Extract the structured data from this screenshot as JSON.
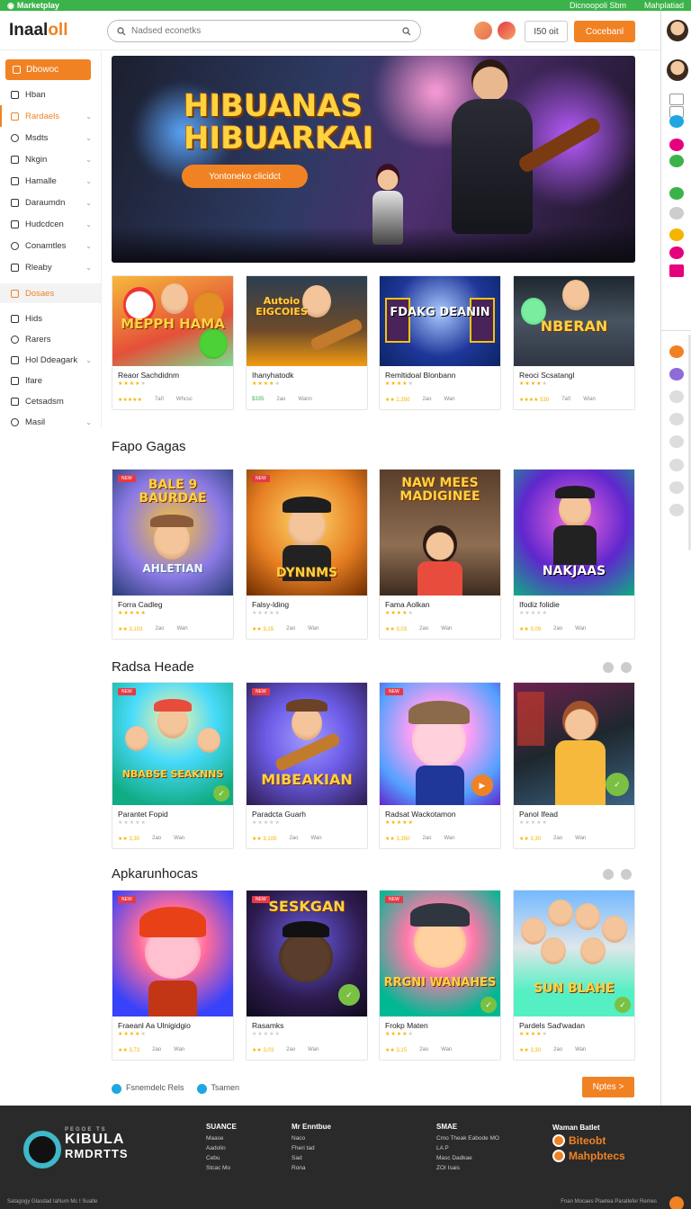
{
  "topbar": {
    "brand": "Marketplay",
    "right_1": "Dicnoopoli Sbm",
    "right_2": "Mahplatiad"
  },
  "header": {
    "logo_a": "Inaal",
    "logo_b": "oll",
    "search_placeholder": "Nadsed econetks",
    "btn_outline": "I50 oit",
    "btn_primary": "Cocebanl"
  },
  "sidebar": {
    "active": "Dbowoc",
    "items": [
      "Hban",
      "Rardaels",
      "Msdts",
      "Nkgin",
      "Hamalle",
      "Daraumdn",
      "Hudcdcen",
      "Conamtles",
      "Rleaby"
    ],
    "block": "Dosaes",
    "items2": [
      "Hids",
      "Rarers",
      "Hol Ddeagark",
      "Ifare",
      "Cetsadsm",
      "Masil"
    ]
  },
  "hero": {
    "title_1": "HIBUANAS",
    "title_2": "HIBUARKAI",
    "cta": "Yontoneko clicidct"
  },
  "row1": [
    {
      "art": "MEPPH HAMA",
      "name": "Reaor Sachdidnm",
      "m1": "★★★★★",
      "m2": "7a0",
      "m3": "Whcsc",
      "stars": 4
    },
    {
      "art": "Autoio EIGCOIES",
      "name": "Ihanyhatodk",
      "m1": "$335",
      "m2": "2ao",
      "m3": "Wann",
      "stars": 4
    },
    {
      "art": "FDAKG DEANIN",
      "name": "Remltidoal Blonbann",
      "m1": "★★ 2,350",
      "m2": "2ao",
      "m3": "Wan",
      "stars": 4
    },
    {
      "art": "NBERAN",
      "name": "Reoci Scsatangl",
      "m1": "★★★★ 530",
      "m2": "7a0",
      "m3": "Wian",
      "stars": 4
    }
  ],
  "sec2": {
    "title": "Fapo Gagas"
  },
  "row2": [
    {
      "art_top": "BALE 9 BAURDAE",
      "art_bot": "AHLETIAN",
      "name": "Forra Cadleg",
      "m1": "★★ 3,103",
      "m2": "2ao",
      "m3": "Wan",
      "stars": 5
    },
    {
      "art_top": "",
      "art_bot": "DYNNMS",
      "name": "Falsy-lding",
      "m1": "★★ 3,15",
      "m2": "2ao",
      "m3": "Wan",
      "stars": 0
    },
    {
      "art_top": "NAW MEES MADIGINEE",
      "art_bot": "",
      "name": "Fama Aolkan",
      "m1": "★★ 3,03",
      "m2": "2ao",
      "m3": "Wan",
      "stars": 4
    },
    {
      "art_top": "",
      "art_bot": "NAKJAAS",
      "name": "Ifodiz folidie",
      "m1": "★★ 3,09",
      "m2": "2ao",
      "m3": "Wan",
      "stars": 0
    }
  ],
  "sec3": {
    "title": "Radsa Heade"
  },
  "row3": [
    {
      "art_bot": "NBABSE SEAKNNS",
      "name": "Parantet Fopid",
      "m1": "★★ 3,30",
      "m2": "2ao",
      "m3": "Wan",
      "stars": 0
    },
    {
      "art_bot": "MIBEAKIAN",
      "name": "Paradcta Guarh",
      "m1": "★★ 3,105",
      "m2": "2ao",
      "m3": "Wan",
      "stars": 0
    },
    {
      "art_bot": "",
      "name": "Radsat Wackotamon",
      "m1": "★★ 3,350",
      "m2": "2ao",
      "m3": "Wan",
      "stars": 5
    },
    {
      "art_bot": "",
      "name": "Panol Ifead",
      "m1": "★★ 3,30",
      "m2": "2ao",
      "m3": "Wan",
      "stars": 0
    }
  ],
  "sec4": {
    "title": "Apkarunhocas"
  },
  "row4": [
    {
      "art_bot": "",
      "name": "Fraeanl Aa Ulnigidgio",
      "m1": "★★ 3,73",
      "m2": "2ao",
      "m3": "Wan",
      "stars": 4
    },
    {
      "art_top": "SESKGAN",
      "art_bot": "",
      "name": "Rasamks",
      "m1": "★★ 3,03",
      "m2": "2ao",
      "m3": "Wan",
      "stars": 0
    },
    {
      "art_bot": "RRGNI WANAHES",
      "name": "Frokp Maten",
      "m1": "★★ 3,15",
      "m2": "2ao",
      "m3": "Wan",
      "stars": 4
    },
    {
      "art_bot": "SUN BLAHE",
      "name": "Pardels Sad'wadan",
      "m1": "★★ 3,30",
      "m2": "2ao",
      "m3": "Wan",
      "stars": 4
    }
  ],
  "bottom": {
    "check_1": "Fsnemdelc Rels",
    "check_2": "Tsamen",
    "next": "Nptes >"
  },
  "footer": {
    "logo_small": "PEGOE TS",
    "logo_big_1": "KIBULA",
    "logo_big_2": "RMDRTTS",
    "col1": {
      "h": "SUANCE",
      "l": [
        "Maase",
        "Aadolin",
        "Cebu",
        "Stcac Mo"
      ]
    },
    "col2": {
      "h": "Mr Enntbue",
      "l": [
        "Naco",
        "Fheri tad",
        "Sad",
        "Rona"
      ]
    },
    "col3": {
      "h": "SMAE",
      "l": [
        "Cmo Theak Eabode MO",
        "LA P",
        "Masc Dadkae",
        "ZOI Isais"
      ]
    },
    "brand": {
      "h": "Waman Batlet",
      "r1": "Biteobt",
      "r2": "Mahpbtecs"
    },
    "bottom_left": "Satagogy Glasdad IaNum Mc I Suatle",
    "bottom_right": "Fnan Mocaes Plaetea Paratlefer Remes"
  },
  "colors": {
    "accent": "#f08224",
    "topbar": "#3bb34a",
    "footer": "#2a2a2a"
  }
}
